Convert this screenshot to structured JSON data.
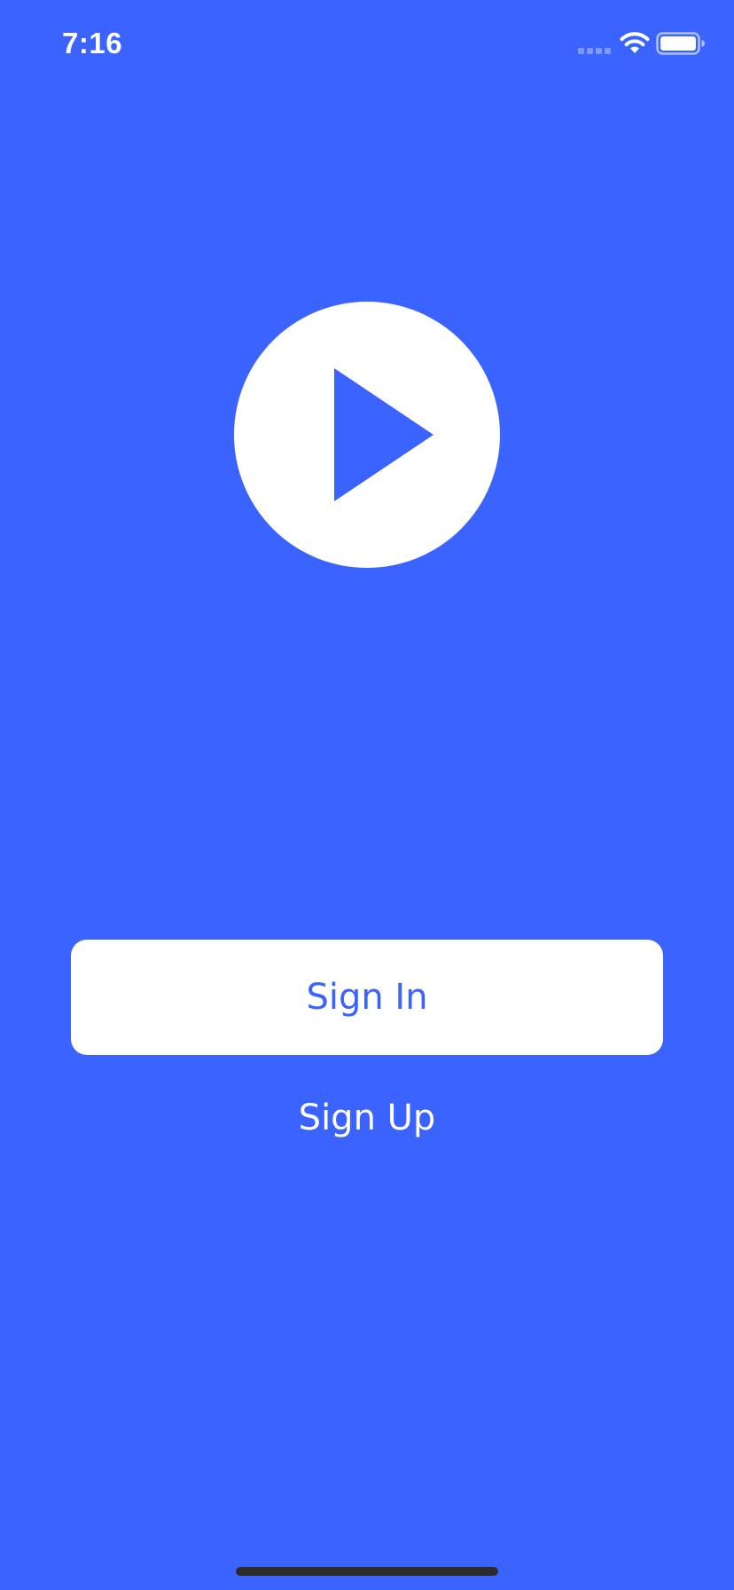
{
  "colors": {
    "background": "#3A63FF",
    "accent": "#3A63FF",
    "button_background": "#FFFFFF",
    "text_light": "#FFFFFF",
    "home_indicator": "#2B2B2B"
  },
  "status_bar": {
    "time": "7:16",
    "icons": [
      "cellular-signal-icon",
      "wifi-icon",
      "battery-icon"
    ]
  },
  "logo": {
    "icon": "play-circle-icon"
  },
  "auth": {
    "sign_in_label": "Sign In",
    "sign_up_label": "Sign Up"
  }
}
